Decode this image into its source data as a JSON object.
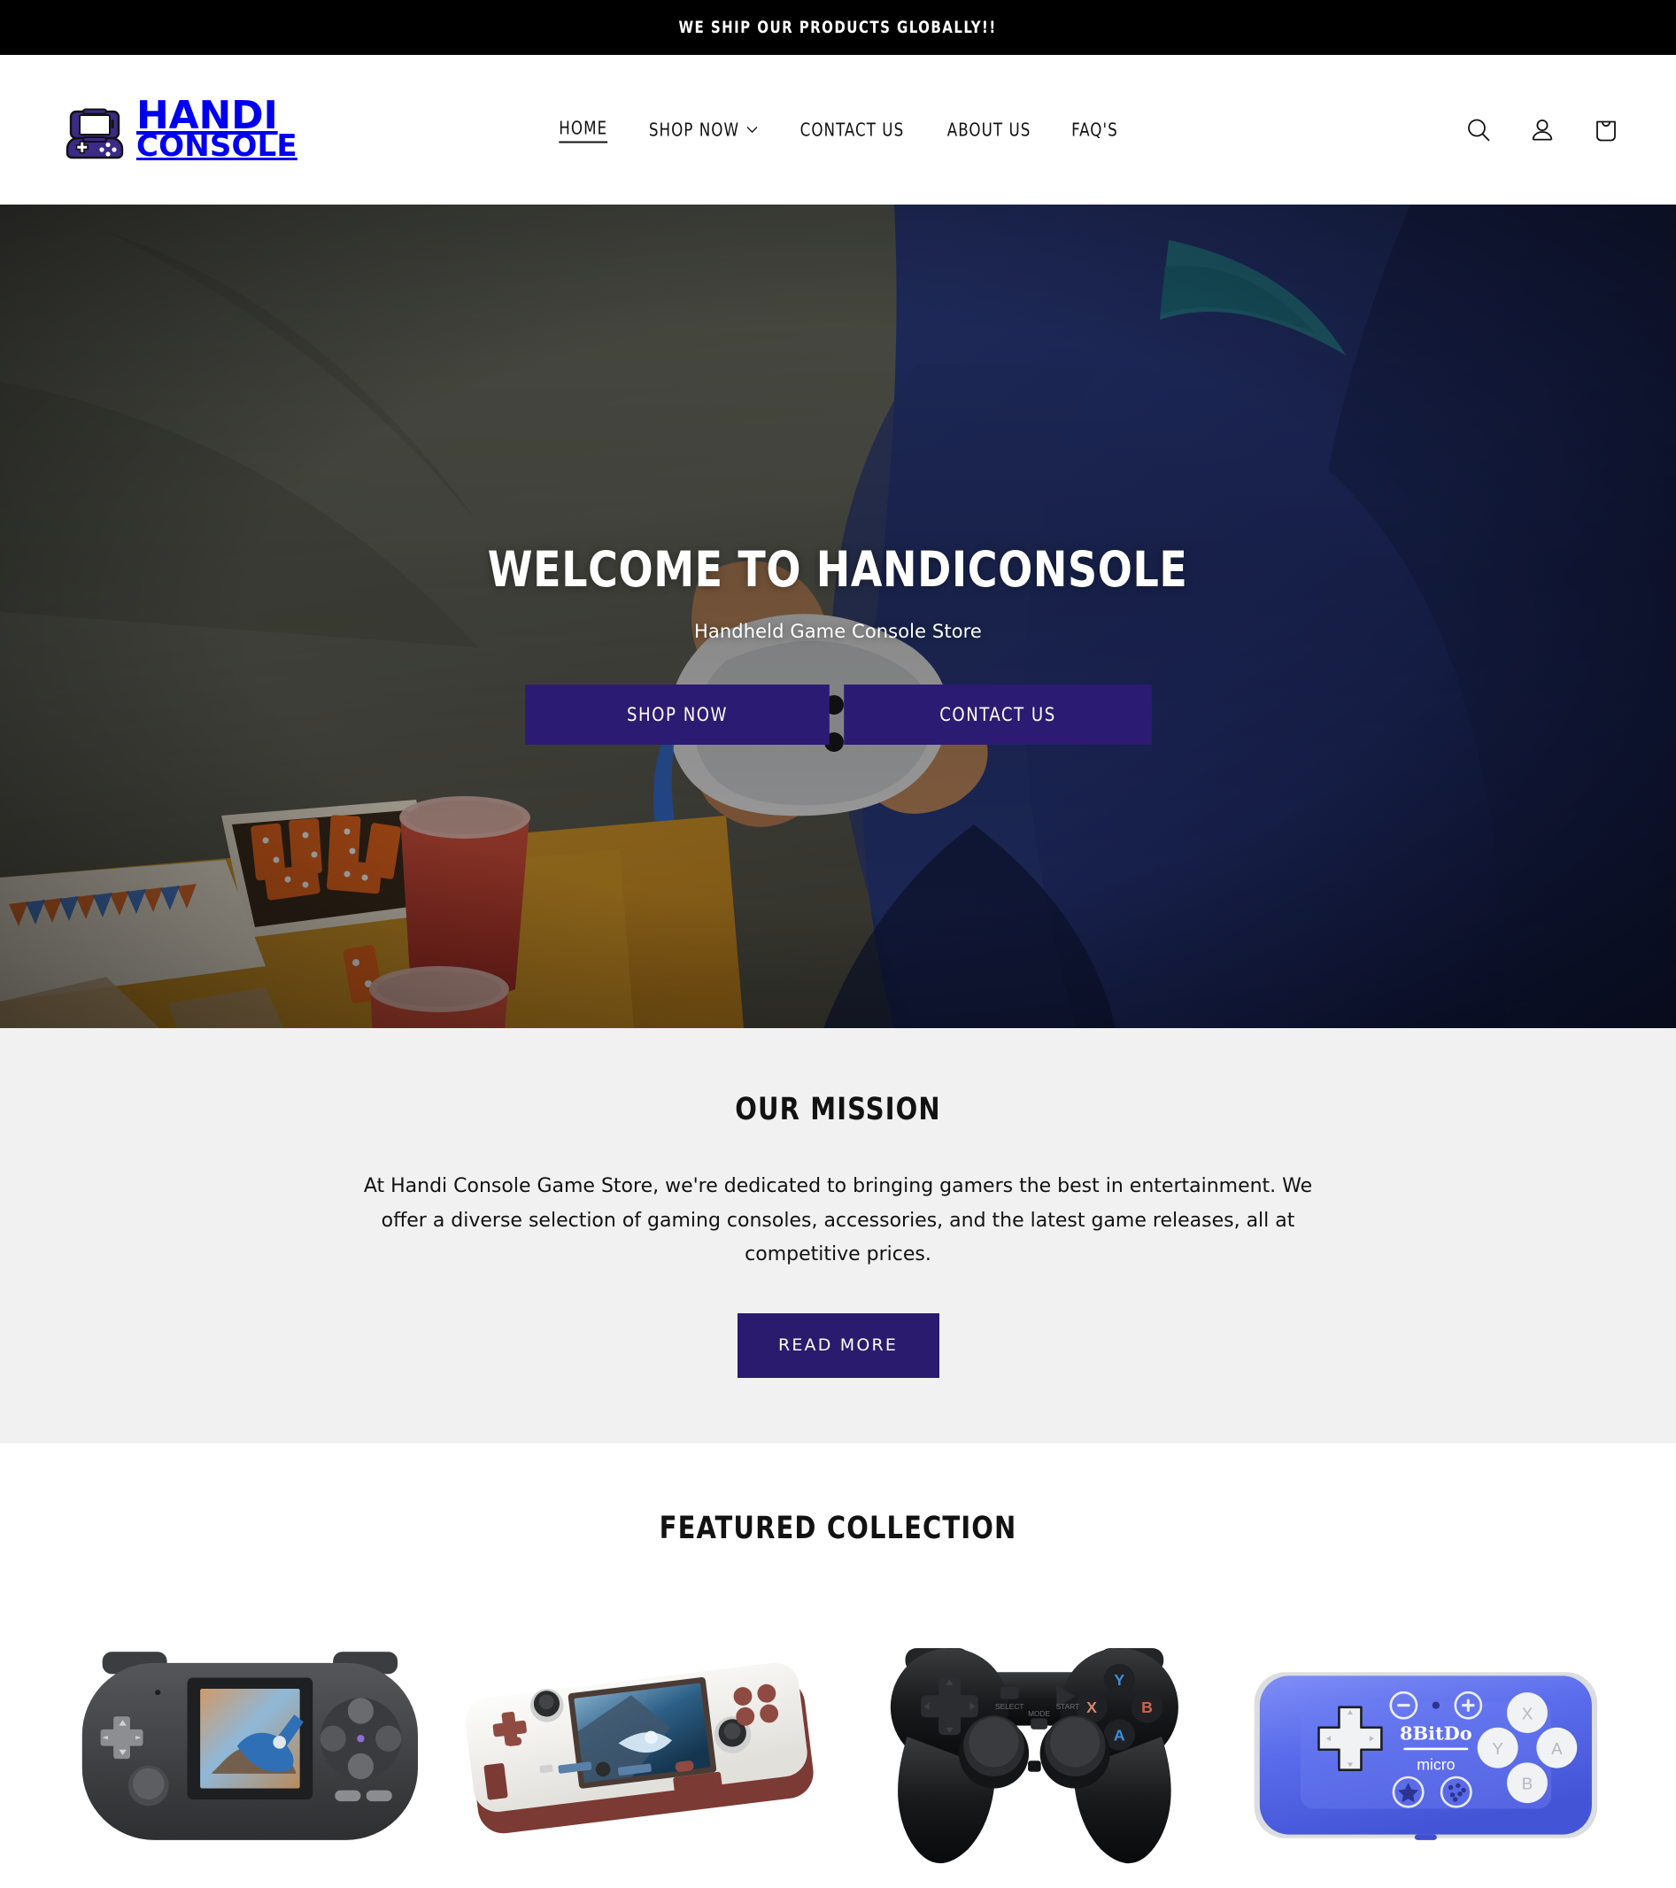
{
  "announcement": {
    "text": "WE SHIP OUR PRODUCTS GLOBALLY!!"
  },
  "header": {
    "logo": {
      "line1": "HANDI",
      "line2": "CONSOLE",
      "icon": "handheld-console-icon",
      "color": "#3b2a86"
    },
    "nav": [
      {
        "label": "HOME",
        "active": true,
        "has_dropdown": false
      },
      {
        "label": "SHOP NOW",
        "active": false,
        "has_dropdown": true
      },
      {
        "label": "CONTACT US",
        "active": false,
        "has_dropdown": false
      },
      {
        "label": "ABOUT US",
        "active": false,
        "has_dropdown": false
      },
      {
        "label": "FAQ'S",
        "active": false,
        "has_dropdown": false
      }
    ],
    "icons": [
      {
        "name": "search-icon"
      },
      {
        "name": "account-icon"
      },
      {
        "name": "cart-icon"
      }
    ]
  },
  "hero": {
    "title": "WELCOME TO HANDICONSOLE",
    "subtitle": "Handheld Game Console Store",
    "buttons": [
      {
        "label": "SHOP NOW",
        "color": "#2c1b73"
      },
      {
        "label": "CONTACT US",
        "color": "#2c1b73"
      }
    ],
    "image_alt": "Person in blue hoodie holding a white game controller, orange dominoes and red cups on a yellow table"
  },
  "mission": {
    "title": "OUR MISSION",
    "body": "At Handi Console Game Store, we're dedicated to bringing gamers the best in entertainment. We offer a diverse selection of gaming consoles, accessories, and the latest game releases, all at competitive prices.",
    "button_label": "READ MORE",
    "background": "#f1f1f1"
  },
  "featured": {
    "title": "FEATURED COLLECTION",
    "products": [
      {
        "name": "black-handheld-console",
        "alt": "Black handheld game console with D-pad, analog stick and color screen showing a tank game"
      },
      {
        "name": "white-handheld-console",
        "alt": "White and dark red handheld game console shown at an angle with blue game on screen"
      },
      {
        "name": "black-wireless-gamepad",
        "alt": "Black wireless gamepad with dual analog sticks and colored Y X B A buttons"
      },
      {
        "name": "blue-mini-controller",
        "alt": "Blue 8BitDo micro mini controller with white D-pad and X Y A B buttons"
      }
    ]
  },
  "theme": {
    "accent": "#2c1b73",
    "accent_dark": "#2a1b6e",
    "announcement_bg": "#000000",
    "text": "#121212",
    "section_gray": "#f1f1f1"
  }
}
